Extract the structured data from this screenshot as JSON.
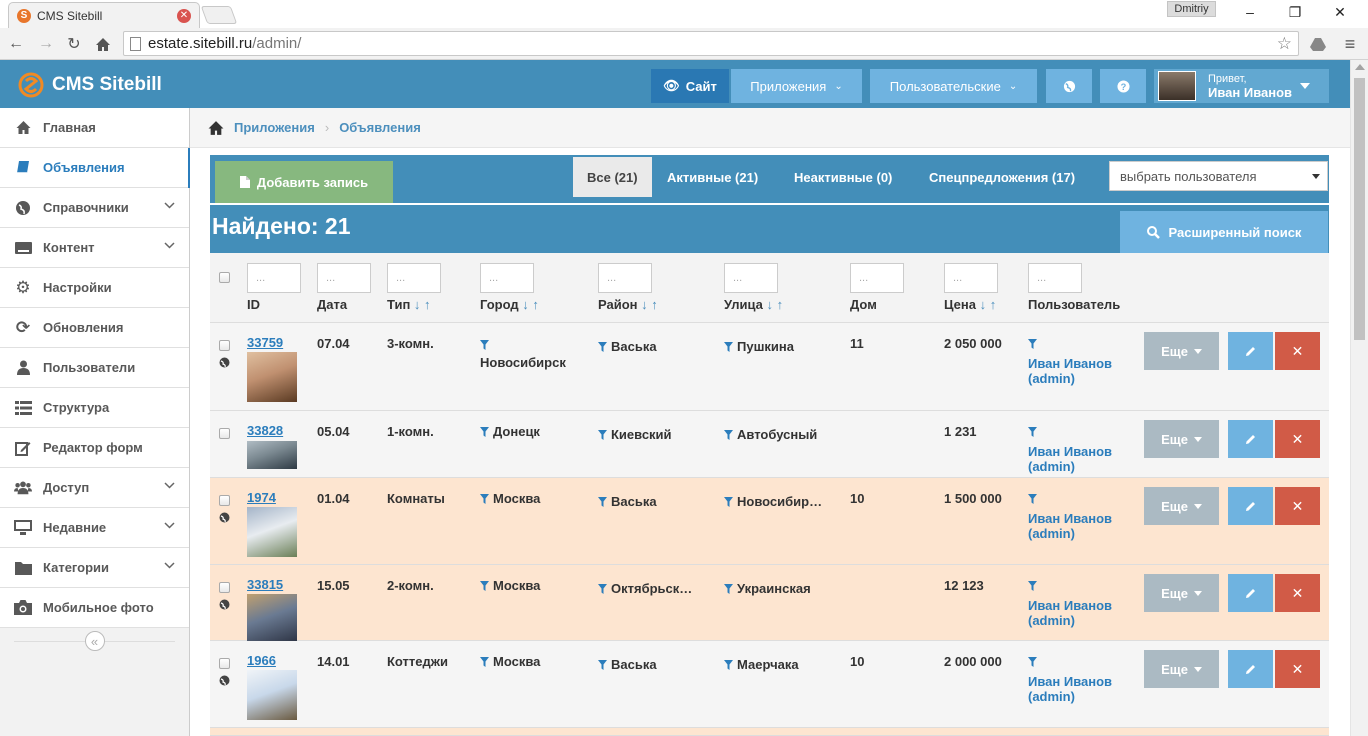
{
  "browser": {
    "tab_title": "CMS Sitebill",
    "favicon_letter": "S",
    "profile_name": "Dmitriy",
    "url_host": "estate.sitebill.ru",
    "url_path": "/admin/"
  },
  "header": {
    "brand": "CMS Sitebill",
    "site_label": "Сайт",
    "apps_label": "Приложения",
    "custom_label": "Пользовательские",
    "greeting": "Привет,",
    "user_name": "Иван Иванов"
  },
  "sidebar": {
    "items": [
      {
        "label": "Главная",
        "icon": "home-icon"
      },
      {
        "label": "Объявления",
        "icon": "book-icon"
      },
      {
        "label": "Справочники",
        "icon": "globe-icon"
      },
      {
        "label": "Контент",
        "icon": "keyboard-icon"
      },
      {
        "label": "Настройки",
        "icon": "gear-icon"
      },
      {
        "label": "Обновления",
        "icon": "refresh-icon"
      },
      {
        "label": "Пользователи",
        "icon": "user-icon"
      },
      {
        "label": "Структура",
        "icon": "list-icon"
      },
      {
        "label": "Редактор форм",
        "icon": "edit-icon"
      },
      {
        "label": "Доступ",
        "icon": "users-icon"
      },
      {
        "label": "Недавние",
        "icon": "desktop-icon"
      },
      {
        "label": "Категории",
        "icon": "folder-icon"
      },
      {
        "label": "Мобильное фото",
        "icon": "camera-icon"
      }
    ]
  },
  "breadcrumb": {
    "level1": "Приложения",
    "level2": "Объявления"
  },
  "toolbar": {
    "add_label": "Добавить запись",
    "tab_all": "Все (21)",
    "tab_active": "Активные (21)",
    "tab_inactive": "Неактивные (0)",
    "tab_special": "Спецпредложения (17)",
    "user_select": "выбрать пользователя",
    "found": "Найдено: 21",
    "advanced_search": "Расширенный поиск"
  },
  "table": {
    "filter_placeholder": "...",
    "headers": {
      "id": "ID",
      "date": "Дата",
      "type": "Тип",
      "city": "Город",
      "district": "Район",
      "street": "Улица",
      "house": "Дом",
      "price": "Цена",
      "user": "Пользователь"
    },
    "sort_arrows": "↓ ↑",
    "more_label": "Еще",
    "rows": [
      {
        "id": "33759",
        "date": "07.04",
        "type": "3-комн.",
        "city": "Новосибирск",
        "district": "Васька",
        "street": "Пушкина",
        "house": "11",
        "price": "2 050 000",
        "user": "Иван Иванов",
        "login": "(admin)"
      },
      {
        "id": "33828",
        "date": "05.04",
        "type": "1-комн.",
        "city": "Донецк",
        "district": "Киевский",
        "street": "Автобусный",
        "house": "",
        "price": "1 231",
        "user": "Иван Иванов",
        "login": "(admin)"
      },
      {
        "id": "1974",
        "date": "01.04",
        "type": "Комнаты",
        "city": "Москва",
        "district": "Васька",
        "street": "Новосибир…",
        "house": "10",
        "price": "1 500 000",
        "user": "Иван Иванов",
        "login": "(admin)"
      },
      {
        "id": "33815",
        "date": "15.05",
        "type": "2-комн.",
        "city": "Москва",
        "district": "Октябрьск…",
        "street": "Украинская",
        "house": "",
        "price": "12 123",
        "user": "Иван Иванов",
        "login": "(admin)"
      },
      {
        "id": "1966",
        "date": "14.01",
        "type": "Коттеджи",
        "city": "Москва",
        "district": "Васька",
        "street": "Маерчака",
        "house": "10",
        "price": "2 000 000",
        "user": "Иван Иванов",
        "login": "(admin)"
      }
    ]
  },
  "colors": {
    "header_blue": "#438eb9",
    "light_blue": "#6fb3e0",
    "green": "#87b87f",
    "red": "#d15b47",
    "highlight_row": "#fde5d0"
  }
}
